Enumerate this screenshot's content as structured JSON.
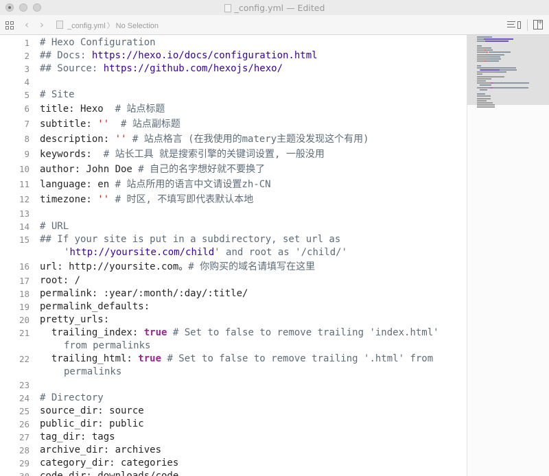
{
  "window": {
    "title": "_config.yml — Edited"
  },
  "jumpbar": {
    "back_glyph": "‹",
    "forward_glyph": "›",
    "file_name": "_config.yml",
    "separator": "〉",
    "selection": "No Selection"
  },
  "icons": {
    "grid": "related-items-grid-icon",
    "back": "chevron-left-icon",
    "forward": "chevron-right-icon",
    "file": "yaml-file-icon",
    "lines": "editor-options-icon",
    "add_editor": "add-editor-icon"
  },
  "colors": {
    "comment": "#5d6c79",
    "url": "#3900a0",
    "string": "#c41a16",
    "keyword": "#9b2393"
  },
  "lines": [
    {
      "n": "1",
      "seg": [
        {
          "t": "# Hexo Configuration",
          "c": "c-comment"
        }
      ]
    },
    {
      "n": "2",
      "seg": [
        {
          "t": "## Docs: ",
          "c": "c-comment"
        },
        {
          "t": "https://hexo.io/docs/configuration.html",
          "c": "c-url"
        }
      ]
    },
    {
      "n": "3",
      "seg": [
        {
          "t": "## Source: ",
          "c": "c-comment"
        },
        {
          "t": "https://github.com/hexojs/hexo/",
          "c": "c-url"
        }
      ]
    },
    {
      "n": "4",
      "seg": []
    },
    {
      "n": "5",
      "seg": [
        {
          "t": "# Site",
          "c": "c-comment"
        }
      ]
    },
    {
      "n": "6",
      "cjk": true,
      "seg": [
        {
          "t": "title: Hexo  ",
          "c": ""
        },
        {
          "t": "# 站点标题",
          "c": "c-comment"
        }
      ]
    },
    {
      "n": "7",
      "cjk": true,
      "seg": [
        {
          "t": "subtitle: ",
          "c": ""
        },
        {
          "t": "''",
          "c": "c-str"
        },
        {
          "t": "  ",
          "c": ""
        },
        {
          "t": "# 站点副标题",
          "c": "c-comment"
        }
      ]
    },
    {
      "n": "8",
      "cjk": true,
      "seg": [
        {
          "t": "description: ",
          "c": ""
        },
        {
          "t": "''",
          "c": "c-str"
        },
        {
          "t": " ",
          "c": ""
        },
        {
          "t": "# 站点格言 (在我使用的matery主题没发现这个有用)",
          "c": "c-comment"
        }
      ]
    },
    {
      "n": "9",
      "cjk": true,
      "seg": [
        {
          "t": "keywords:  ",
          "c": ""
        },
        {
          "t": "# 站长工具 就是搜索引擎的关键词设置, 一般没用",
          "c": "c-comment"
        }
      ]
    },
    {
      "n": "10",
      "cjk": true,
      "seg": [
        {
          "t": "author: John Doe ",
          "c": ""
        },
        {
          "t": "# 自己的名字想好就不要换了",
          "c": "c-comment"
        }
      ]
    },
    {
      "n": "11",
      "cjk": true,
      "seg": [
        {
          "t": "language: en ",
          "c": ""
        },
        {
          "t": "# 站点所用的语言中文请设置zh-CN",
          "c": "c-comment"
        }
      ]
    },
    {
      "n": "12",
      "cjk": true,
      "seg": [
        {
          "t": "timezone: ",
          "c": ""
        },
        {
          "t": "''",
          "c": "c-str"
        },
        {
          "t": " ",
          "c": ""
        },
        {
          "t": "# 时区, 不填写即代表默认本地",
          "c": "c-comment"
        }
      ]
    },
    {
      "n": "13",
      "seg": []
    },
    {
      "n": "14",
      "seg": [
        {
          "t": "# URL",
          "c": "c-comment"
        }
      ]
    },
    {
      "n": "15",
      "seg": [
        {
          "t": "## If your site is put in a subdirectory, set url as",
          "c": "c-comment"
        }
      ]
    },
    {
      "n": "",
      "wrap": true,
      "seg": [
        {
          "t": "'",
          "c": "c-comment"
        },
        {
          "t": "http://yoursite.com/child",
          "c": "c-url"
        },
        {
          "t": "' and root as '/child/'",
          "c": "c-comment"
        }
      ]
    },
    {
      "n": "16",
      "cjk": true,
      "seg": [
        {
          "t": "url: http://yoursite.com。",
          "c": ""
        },
        {
          "t": "# 你购买的域名请填写在这里",
          "c": "c-comment"
        }
      ]
    },
    {
      "n": "17",
      "seg": [
        {
          "t": "root: /",
          "c": ""
        }
      ]
    },
    {
      "n": "18",
      "seg": [
        {
          "t": "permalink: :year/:month/:day/:title/",
          "c": ""
        }
      ]
    },
    {
      "n": "19",
      "seg": [
        {
          "t": "permalink_defaults:",
          "c": ""
        }
      ]
    },
    {
      "n": "20",
      "seg": [
        {
          "t": "pretty_urls:",
          "c": ""
        }
      ]
    },
    {
      "n": "21",
      "seg": [
        {
          "t": "  trailing_index: ",
          "c": ""
        },
        {
          "t": "true",
          "c": "c-kw"
        },
        {
          "t": " # Set to false to remove trailing 'index.html'",
          "c": "c-comment"
        }
      ]
    },
    {
      "n": "",
      "wrap": true,
      "seg": [
        {
          "t": "from permalinks",
          "c": "c-comment"
        }
      ]
    },
    {
      "n": "22",
      "seg": [
        {
          "t": "  trailing_html: ",
          "c": ""
        },
        {
          "t": "true",
          "c": "c-kw"
        },
        {
          "t": " # Set to false to remove trailing '.html' from",
          "c": "c-comment"
        }
      ]
    },
    {
      "n": "",
      "wrap": true,
      "seg": [
        {
          "t": "permalinks",
          "c": "c-comment"
        }
      ]
    },
    {
      "n": "23",
      "seg": []
    },
    {
      "n": "24",
      "seg": [
        {
          "t": "# Directory",
          "c": "c-comment"
        }
      ]
    },
    {
      "n": "25",
      "seg": [
        {
          "t": "source_dir: source",
          "c": ""
        }
      ]
    },
    {
      "n": "26",
      "seg": [
        {
          "t": "public_dir: public",
          "c": ""
        }
      ]
    },
    {
      "n": "27",
      "seg": [
        {
          "t": "tag_dir: tags",
          "c": ""
        }
      ]
    },
    {
      "n": "28",
      "seg": [
        {
          "t": "archive_dir: archives",
          "c": ""
        }
      ]
    },
    {
      "n": "29",
      "seg": [
        {
          "t": "category_dir: categories",
          "c": ""
        }
      ]
    },
    {
      "n": "30",
      "seg": [
        {
          "t": "code_dir: downloads/code",
          "c": ""
        }
      ]
    }
  ]
}
